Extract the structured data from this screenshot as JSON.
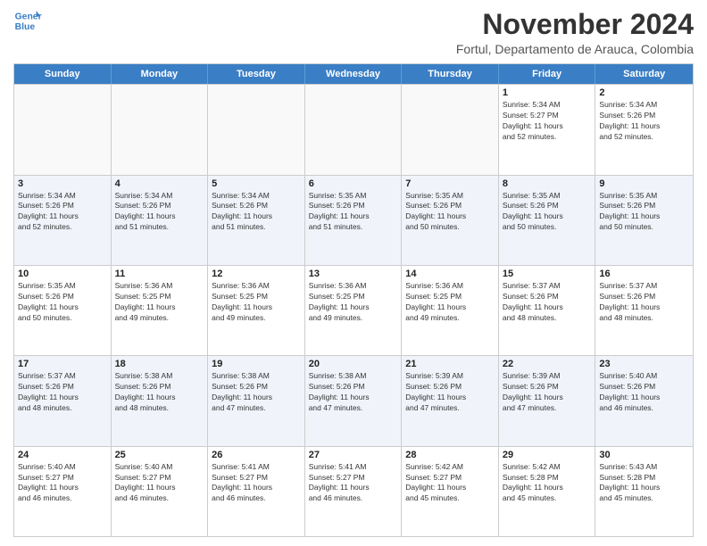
{
  "logo": {
    "line1": "General",
    "line2": "Blue"
  },
  "header": {
    "month": "November 2024",
    "location": "Fortul, Departamento de Arauca, Colombia"
  },
  "weekdays": [
    "Sunday",
    "Monday",
    "Tuesday",
    "Wednesday",
    "Thursday",
    "Friday",
    "Saturday"
  ],
  "rows": [
    [
      {
        "day": "",
        "info": ""
      },
      {
        "day": "",
        "info": ""
      },
      {
        "day": "",
        "info": ""
      },
      {
        "day": "",
        "info": ""
      },
      {
        "day": "",
        "info": ""
      },
      {
        "day": "1",
        "info": "Sunrise: 5:34 AM\nSunset: 5:27 PM\nDaylight: 11 hours\nand 52 minutes."
      },
      {
        "day": "2",
        "info": "Sunrise: 5:34 AM\nSunset: 5:26 PM\nDaylight: 11 hours\nand 52 minutes."
      }
    ],
    [
      {
        "day": "3",
        "info": "Sunrise: 5:34 AM\nSunset: 5:26 PM\nDaylight: 11 hours\nand 52 minutes."
      },
      {
        "day": "4",
        "info": "Sunrise: 5:34 AM\nSunset: 5:26 PM\nDaylight: 11 hours\nand 51 minutes."
      },
      {
        "day": "5",
        "info": "Sunrise: 5:34 AM\nSunset: 5:26 PM\nDaylight: 11 hours\nand 51 minutes."
      },
      {
        "day": "6",
        "info": "Sunrise: 5:35 AM\nSunset: 5:26 PM\nDaylight: 11 hours\nand 51 minutes."
      },
      {
        "day": "7",
        "info": "Sunrise: 5:35 AM\nSunset: 5:26 PM\nDaylight: 11 hours\nand 50 minutes."
      },
      {
        "day": "8",
        "info": "Sunrise: 5:35 AM\nSunset: 5:26 PM\nDaylight: 11 hours\nand 50 minutes."
      },
      {
        "day": "9",
        "info": "Sunrise: 5:35 AM\nSunset: 5:26 PM\nDaylight: 11 hours\nand 50 minutes."
      }
    ],
    [
      {
        "day": "10",
        "info": "Sunrise: 5:35 AM\nSunset: 5:26 PM\nDaylight: 11 hours\nand 50 minutes."
      },
      {
        "day": "11",
        "info": "Sunrise: 5:36 AM\nSunset: 5:25 PM\nDaylight: 11 hours\nand 49 minutes."
      },
      {
        "day": "12",
        "info": "Sunrise: 5:36 AM\nSunset: 5:25 PM\nDaylight: 11 hours\nand 49 minutes."
      },
      {
        "day": "13",
        "info": "Sunrise: 5:36 AM\nSunset: 5:25 PM\nDaylight: 11 hours\nand 49 minutes."
      },
      {
        "day": "14",
        "info": "Sunrise: 5:36 AM\nSunset: 5:25 PM\nDaylight: 11 hours\nand 49 minutes."
      },
      {
        "day": "15",
        "info": "Sunrise: 5:37 AM\nSunset: 5:26 PM\nDaylight: 11 hours\nand 48 minutes."
      },
      {
        "day": "16",
        "info": "Sunrise: 5:37 AM\nSunset: 5:26 PM\nDaylight: 11 hours\nand 48 minutes."
      }
    ],
    [
      {
        "day": "17",
        "info": "Sunrise: 5:37 AM\nSunset: 5:26 PM\nDaylight: 11 hours\nand 48 minutes."
      },
      {
        "day": "18",
        "info": "Sunrise: 5:38 AM\nSunset: 5:26 PM\nDaylight: 11 hours\nand 48 minutes."
      },
      {
        "day": "19",
        "info": "Sunrise: 5:38 AM\nSunset: 5:26 PM\nDaylight: 11 hours\nand 47 minutes."
      },
      {
        "day": "20",
        "info": "Sunrise: 5:38 AM\nSunset: 5:26 PM\nDaylight: 11 hours\nand 47 minutes."
      },
      {
        "day": "21",
        "info": "Sunrise: 5:39 AM\nSunset: 5:26 PM\nDaylight: 11 hours\nand 47 minutes."
      },
      {
        "day": "22",
        "info": "Sunrise: 5:39 AM\nSunset: 5:26 PM\nDaylight: 11 hours\nand 47 minutes."
      },
      {
        "day": "23",
        "info": "Sunrise: 5:40 AM\nSunset: 5:26 PM\nDaylight: 11 hours\nand 46 minutes."
      }
    ],
    [
      {
        "day": "24",
        "info": "Sunrise: 5:40 AM\nSunset: 5:27 PM\nDaylight: 11 hours\nand 46 minutes."
      },
      {
        "day": "25",
        "info": "Sunrise: 5:40 AM\nSunset: 5:27 PM\nDaylight: 11 hours\nand 46 minutes."
      },
      {
        "day": "26",
        "info": "Sunrise: 5:41 AM\nSunset: 5:27 PM\nDaylight: 11 hours\nand 46 minutes."
      },
      {
        "day": "27",
        "info": "Sunrise: 5:41 AM\nSunset: 5:27 PM\nDaylight: 11 hours\nand 46 minutes."
      },
      {
        "day": "28",
        "info": "Sunrise: 5:42 AM\nSunset: 5:27 PM\nDaylight: 11 hours\nand 45 minutes."
      },
      {
        "day": "29",
        "info": "Sunrise: 5:42 AM\nSunset: 5:28 PM\nDaylight: 11 hours\nand 45 minutes."
      },
      {
        "day": "30",
        "info": "Sunrise: 5:43 AM\nSunset: 5:28 PM\nDaylight: 11 hours\nand 45 minutes."
      }
    ]
  ]
}
